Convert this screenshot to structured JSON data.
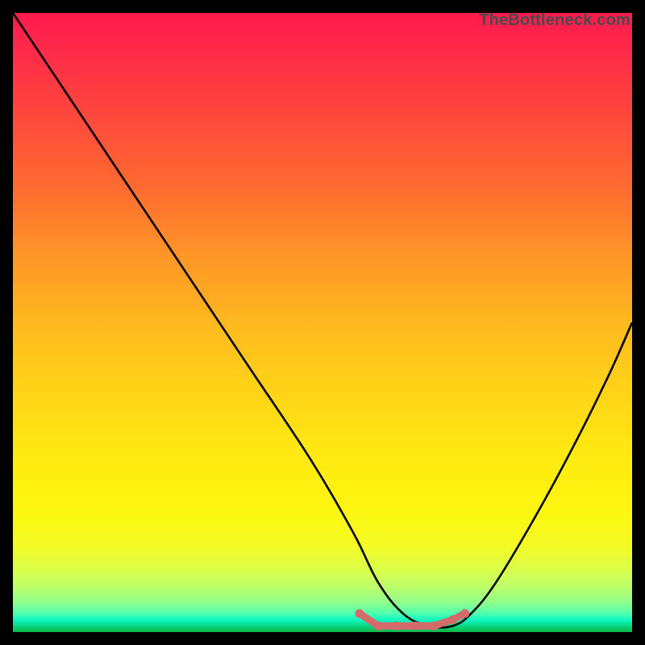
{
  "watermark": {
    "text": "TheBottleneck.com"
  },
  "chart_data": {
    "type": "line",
    "title": "",
    "xlabel": "",
    "ylabel": "",
    "xlim": [
      0,
      100
    ],
    "ylim": [
      0,
      100
    ],
    "grid": false,
    "series": [
      {
        "name": "bottleneck-curve",
        "x": [
          0,
          8,
          18,
          28,
          38,
          48,
          55,
          59,
          63,
          67,
          71,
          74,
          78,
          84,
          90,
          96,
          100
        ],
        "values": [
          100,
          88,
          73,
          58,
          43,
          28,
          16,
          8,
          3,
          1,
          1,
          3,
          8,
          18,
          29,
          41,
          50
        ]
      }
    ],
    "markers": {
      "name": "valley-markers",
      "color": "#d46a6a",
      "x": [
        56,
        59,
        62,
        65,
        68,
        71,
        73
      ],
      "values": [
        3,
        1,
        1,
        1,
        1,
        2,
        3
      ]
    },
    "background_gradient": {
      "top": "#ff1a4d",
      "mid": "#ffe712",
      "bottom": "#0ab84a"
    }
  }
}
